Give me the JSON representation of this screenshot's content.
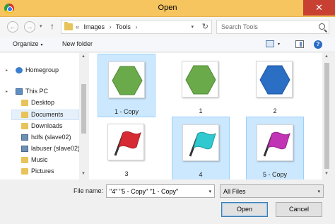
{
  "window": {
    "title": "Open",
    "close_glyph": "✕"
  },
  "nav": {
    "back_glyph": "←",
    "forward_glyph": "→",
    "dropdown_glyph": "▾",
    "up_glyph": "↑",
    "breadcrumb": [
      "«",
      "Images",
      "›",
      "Tools",
      "›"
    ],
    "address_dropdown_glyph": "▾",
    "refresh_glyph": "↻",
    "search_placeholder": "Search Tools"
  },
  "toolbar": {
    "organize_label": "Organize",
    "organize_caret": "▾",
    "new_folder_label": "New folder",
    "view_caret": "▾",
    "help_glyph": "?"
  },
  "sidebar": {
    "items": [
      {
        "label": "Homegroup",
        "icon": "homegroup-icon"
      },
      {
        "label": "This PC",
        "icon": "computer-icon"
      },
      {
        "label": "Desktop",
        "icon": "folder-icon"
      },
      {
        "label": "Documents",
        "icon": "folder-icon",
        "selected": true
      },
      {
        "label": "Downloads",
        "icon": "folder-icon"
      },
      {
        "label": "hdfs (slave02)",
        "icon": "network-user-icon"
      },
      {
        "label": "labuser (slave02)",
        "icon": "network-user-icon"
      },
      {
        "label": "Music",
        "icon": "music-folder-icon"
      },
      {
        "label": "Pictures",
        "icon": "folder-icon"
      }
    ],
    "expand_glyph": "▸",
    "scroll_up_glyph": "▲",
    "scroll_down_glyph": "▼"
  },
  "files": [
    {
      "name": "1 - Copy",
      "shape": "hexagon",
      "color": "#6aaa4a",
      "selected": true
    },
    {
      "name": "1",
      "shape": "hexagon",
      "color": "#6aaa4a",
      "selected": false
    },
    {
      "name": "2",
      "shape": "hexagon",
      "color": "#2a6fc4",
      "selected": false
    },
    {
      "name": "3",
      "shape": "flag",
      "color": "#d62b35",
      "selected": false
    },
    {
      "name": "4",
      "shape": "flag",
      "color": "#2fc9cf",
      "selected": true
    },
    {
      "name": "5 - Copy",
      "shape": "flag",
      "color": "#c234b6",
      "selected": true
    }
  ],
  "content_scroll": {
    "up_glyph": "▲",
    "down_glyph": "▼"
  },
  "bottom": {
    "file_name_label": "File name:",
    "file_name_value": "\"4\" \"5 - Copy\" \"1 - Copy\"",
    "file_name_dropdown_glyph": "▾",
    "filter_value": "All Files",
    "filter_dropdown_glyph": "▾",
    "open_label": "Open",
    "cancel_label": "Cancel"
  }
}
